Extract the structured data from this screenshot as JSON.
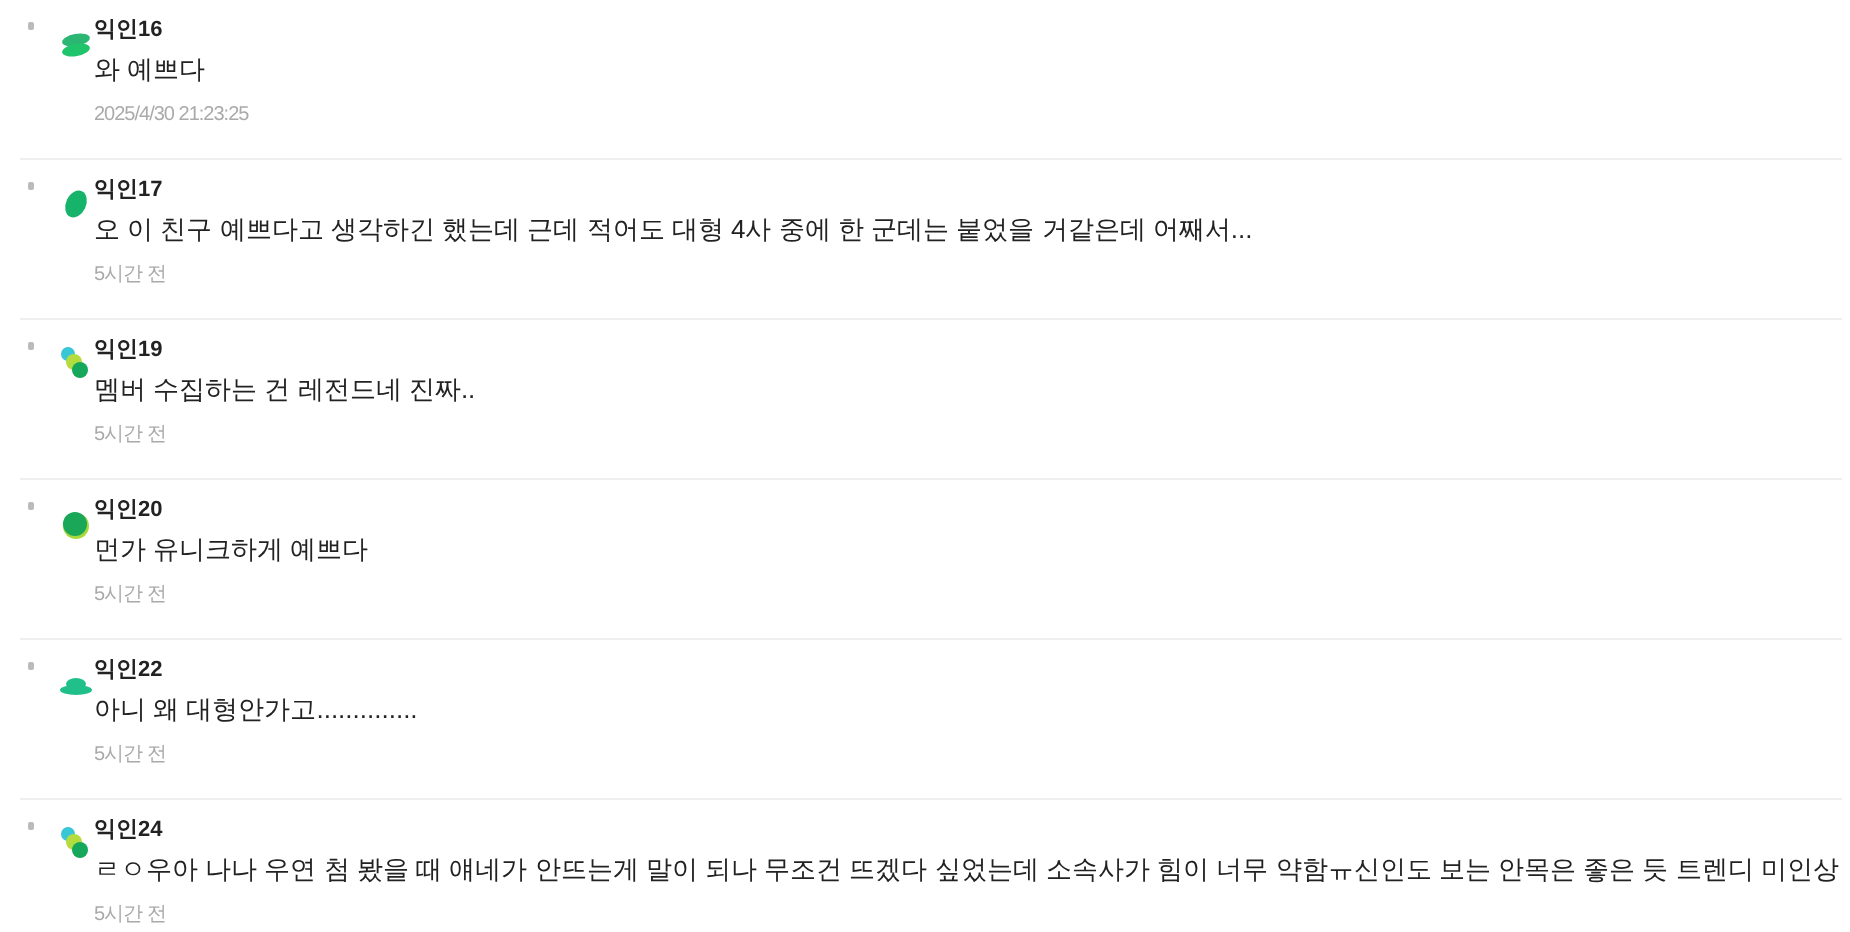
{
  "comments": [
    {
      "author": "익인16",
      "text": "와 예쁘다",
      "time": "2025/4/30 21:23:25",
      "avatar": {
        "kind": "stack"
      }
    },
    {
      "author": "익인17",
      "text": "오 이 친구 예쁘다고 생각하긴 했는데 근데 적어도 대형 4사 중에 한 군데는 붙었을 거같은데 어째서...",
      "time": "5시간 전",
      "avatar": {
        "kind": "leaf"
      }
    },
    {
      "author": "익인19",
      "text": "멤버 수집하는 건 레전드네 진짜..",
      "time": "5시간 전",
      "avatar": {
        "kind": "dots"
      }
    },
    {
      "author": "익인20",
      "text": "먼가 유니크하게 예쁘다",
      "time": "5시간 전",
      "avatar": {
        "kind": "circle"
      }
    },
    {
      "author": "익인22",
      "text": "아니 왜 대형안가고..............",
      "time": "5시간 전",
      "avatar": {
        "kind": "dome"
      }
    },
    {
      "author": "익인24",
      "text": "ㄹㅇ우아 나나 우연 첨 봤을 때 얘네가 안뜨는게 말이 되나 무조건 뜨겠다 싶었는데 소속사가 힘이 너무 약함ㅠ신인도 보는 안목은 좋은 듯 트렌디 미인상",
      "time": "5시간 전",
      "avatar": {
        "kind": "dots"
      }
    }
  ]
}
